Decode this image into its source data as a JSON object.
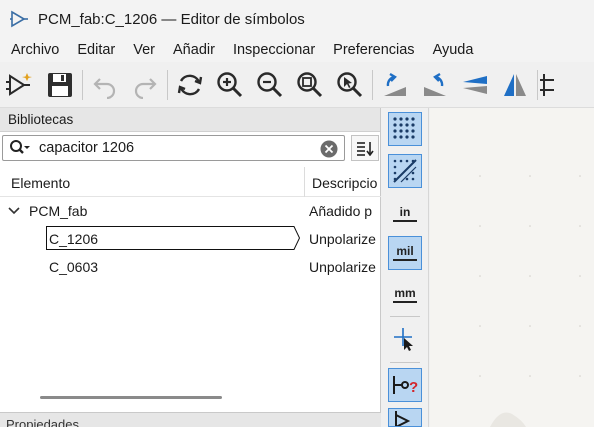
{
  "window": {
    "title": "PCM_fab:C_1206 — Editor de símbolos"
  },
  "menu": [
    "Archivo",
    "Editar",
    "Ver",
    "Añadir",
    "Inspeccionar",
    "Preferencias",
    "Ayuda"
  ],
  "toolbar": {
    "buttons": [
      "new-symbol-icon",
      "save-icon",
      "undo-icon",
      "redo-icon",
      "refresh-icon",
      "zoom-in-icon",
      "zoom-out-icon",
      "zoom-fit-icon",
      "zoom-selection-icon",
      "rotate-ccw-icon",
      "rotate-cw-icon",
      "mirror-vertical-icon",
      "mirror-horizontal-icon",
      "pin-table-icon"
    ]
  },
  "libraries": {
    "header": "Bibliotecas",
    "search": {
      "value": "capacitor 1206",
      "placeholder": ""
    },
    "columns": {
      "element": "Elemento",
      "description": "Descripcion"
    },
    "tree": {
      "library": {
        "name": "PCM_fab",
        "desc": "Añadido p"
      },
      "items": [
        {
          "name": "C_1206",
          "desc": "Unpolarize",
          "selected": true
        },
        {
          "name": "C_0603",
          "desc": "Unpolarize",
          "selected": false
        }
      ]
    }
  },
  "bottom_panel": {
    "label": "Propiedades"
  },
  "left_tools": {
    "units": {
      "inch": "in",
      "mil": "mil",
      "mm": "mm"
    },
    "active": [
      "grid-dots-icon",
      "grid-overlay-icon",
      "mil-unit"
    ]
  },
  "colors": {
    "accent": "#4a90d9",
    "active_bg": "#b9d6f2",
    "canvas": "#f5f4f1"
  }
}
